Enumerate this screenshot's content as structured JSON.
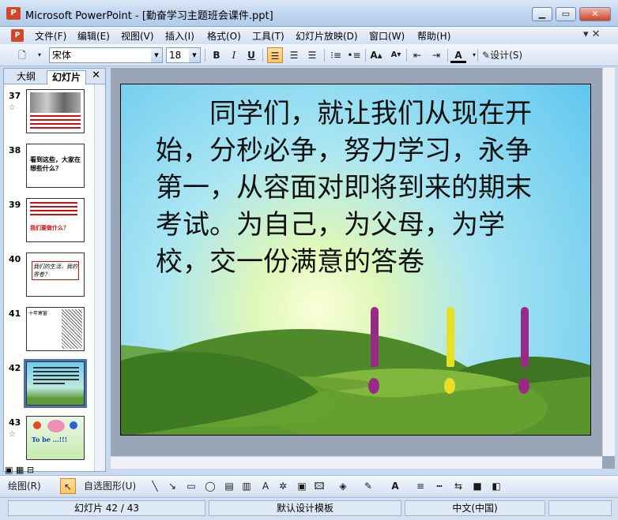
{
  "window": {
    "title": "Microsoft PowerPoint - [勤奋学习主题班会课件.ppt]",
    "app_icon": "powerpoint-icon",
    "minimize": "▁",
    "maximize": "▭",
    "close": "✕"
  },
  "menubar": {
    "items": [
      "文件(F)",
      "编辑(E)",
      "视图(V)",
      "插入(I)",
      "格式(O)",
      "工具(T)",
      "幻灯片放映(D)",
      "窗口(W)",
      "帮助(H)"
    ],
    "right_icon": "▾ ✕"
  },
  "toolbar": {
    "font_name": "宋体",
    "font_size": "18",
    "bold": "B",
    "italic": "I",
    "underline": "U",
    "design_label": "设计(S)"
  },
  "outline_pane": {
    "tabs": [
      "大纲",
      "幻灯片"
    ],
    "close": "✕",
    "slides": [
      {
        "num": "37",
        "star": "☆",
        "text": ""
      },
      {
        "num": "38",
        "star": "",
        "text": "看到这些，大家在想些什么？"
      },
      {
        "num": "39",
        "star": "",
        "text": "我们要做什么？"
      },
      {
        "num": "40",
        "star": "",
        "text": "我们的生活，我的答卷？"
      },
      {
        "num": "41",
        "star": "",
        "text": "十年寒窗"
      },
      {
        "num": "42",
        "star": "",
        "text": ""
      },
      {
        "num": "43",
        "star": "☆",
        "text": "To be …!!!"
      }
    ]
  },
  "slide": {
    "body_text": "同学们，就让我们从现在开始，分秒必争，努力学习，永争第一，从容面对即将到来的期末考试。为自己，为父母，为学校，交一份满意的答卷",
    "exclaim_colors": [
      "#9a2a8a",
      "#e8e020",
      "#9a2a8a"
    ]
  },
  "drawbar": {
    "draw_label": "绘图(R)",
    "autoshape_label": "自选图形(U)"
  },
  "statusbar": {
    "slide_pos": "幻灯片 42 / 43",
    "template": "默认设计模板",
    "language": "中文(中国)"
  }
}
